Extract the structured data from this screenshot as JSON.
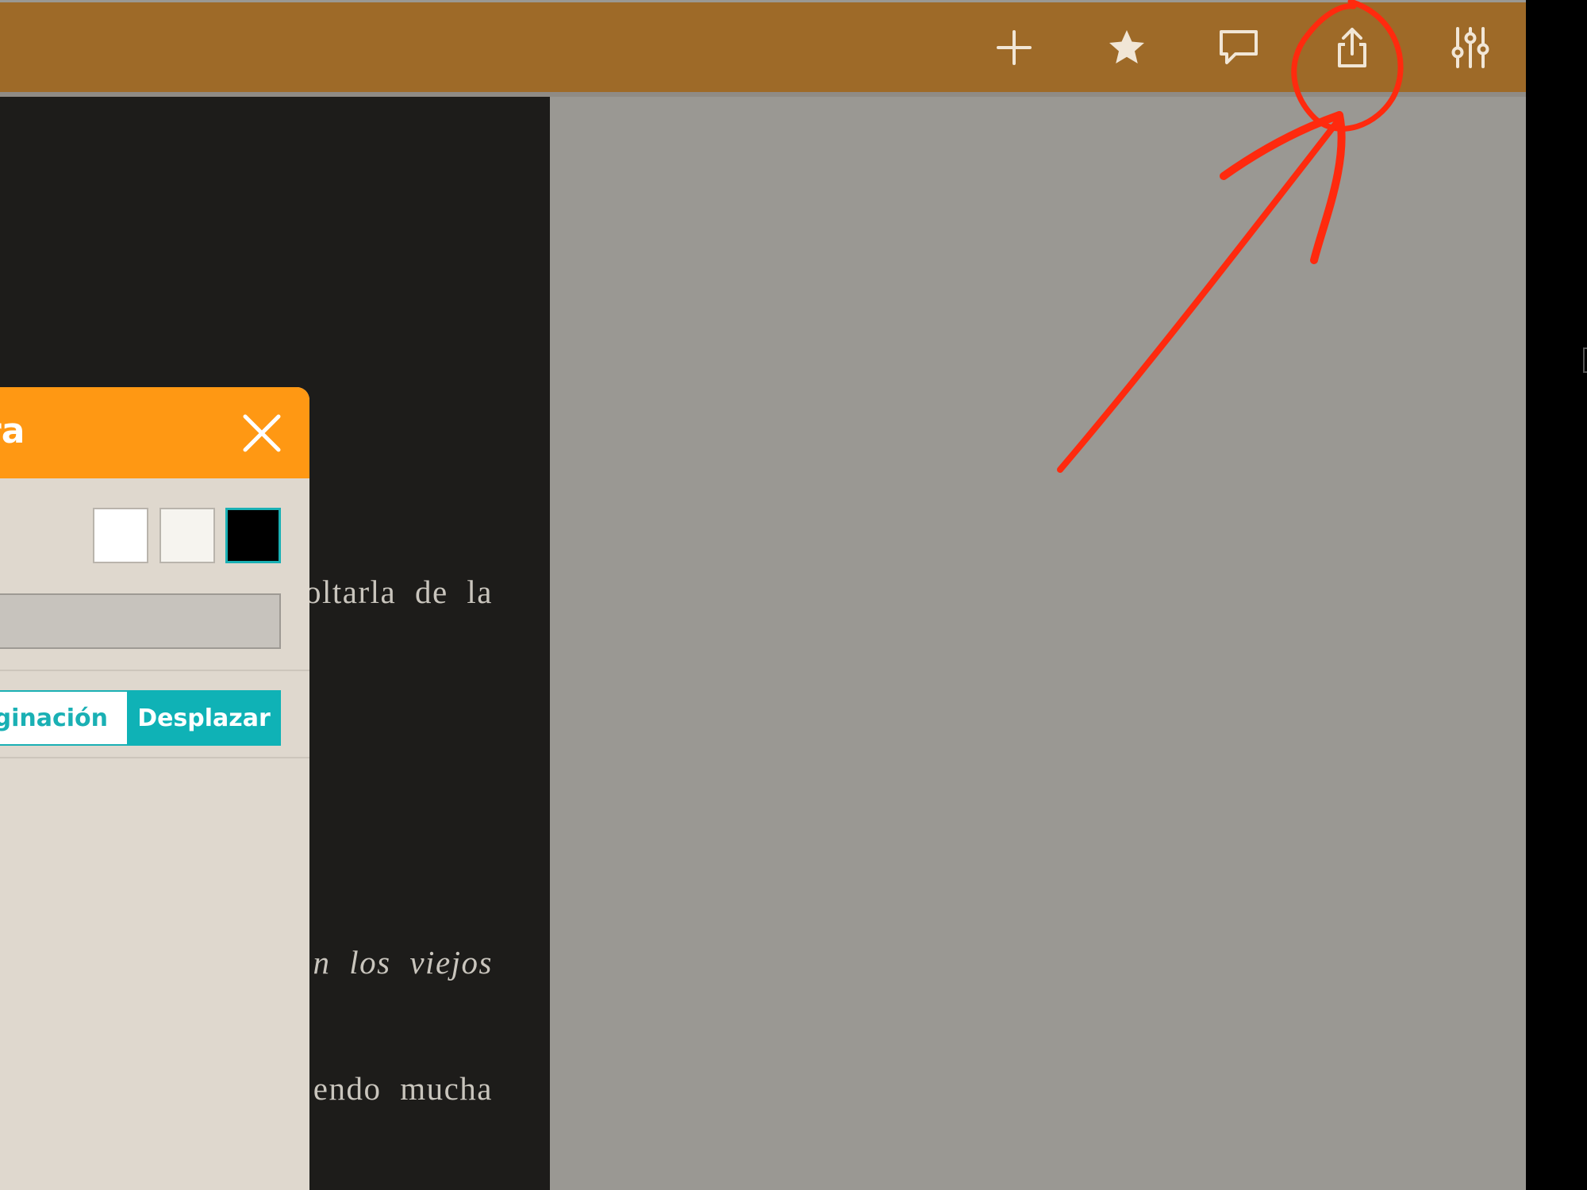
{
  "toolbar": {
    "background": "#9e6a28",
    "icon_color": "#f1e6d6",
    "buttons": [
      {
        "icon": "plus-icon",
        "label": "add"
      },
      {
        "icon": "star-icon",
        "label": "bookmark"
      },
      {
        "icon": "comment-icon",
        "label": "comment"
      },
      {
        "icon": "share-icon",
        "label": "share"
      },
      {
        "icon": "sliders-icon",
        "label": "settings"
      }
    ]
  },
  "book": {
    "lines": [
      {
        "text": "oltarla de la",
        "italic": false
      },
      {
        "text": "n los viejos",
        "italic": true
      },
      {
        "text": "endo mucha",
        "italic": false
      }
    ]
  },
  "panel": {
    "title": "ra",
    "header_color": "#ff9813",
    "accent_color": "#1ab0b4",
    "swatches": [
      "#ffffff",
      "#f6f4ef",
      "#000000"
    ],
    "selected_swatch": "#000000",
    "paginate_label": "aginación",
    "scroll_label": "Desplazar",
    "selected_mode": "Desplazar"
  },
  "annotation": {
    "color": "#ff2a0e",
    "target": "share-icon"
  }
}
